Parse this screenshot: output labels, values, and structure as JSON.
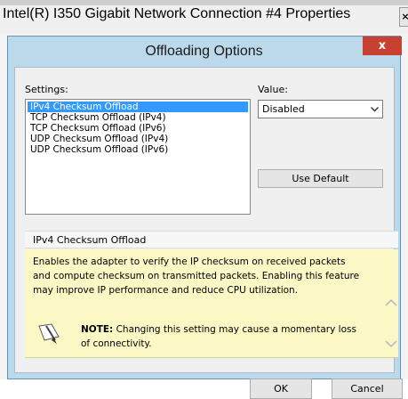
{
  "parent_window": {
    "title": "Intel(R) I350 Gigabit Network Connection #4 Properties",
    "close_glyph": "×"
  },
  "dialog": {
    "title": "Offloading Options",
    "close_glyph": "x",
    "settings_label": "Settings:",
    "value_label": "Value:",
    "settings_items": [
      "IPv4 Checksum Offload",
      "TCP Checksum Offload (IPv4)",
      "TCP Checksum Offload (IPv6)",
      "UDP Checksum Offload (IPv4)",
      "UDP Checksum Offload (IPv6)"
    ],
    "selected_setting": "IPv4 Checksum Offload",
    "value_selected": "Disabled",
    "use_default_label": "Use Default",
    "description_header": "IPv4 Checksum Offload",
    "description_text": "Enables the adapter to verify the IP checksum on received packets and compute checksum on transmitted packets. Enabling this feature may improve IP performance and reduce CPU utilization.",
    "note_label": "NOTE:",
    "note_text": "Changing this setting may cause a momentary loss of connectivity.",
    "ok_label": "OK",
    "cancel_label": "Cancel"
  }
}
